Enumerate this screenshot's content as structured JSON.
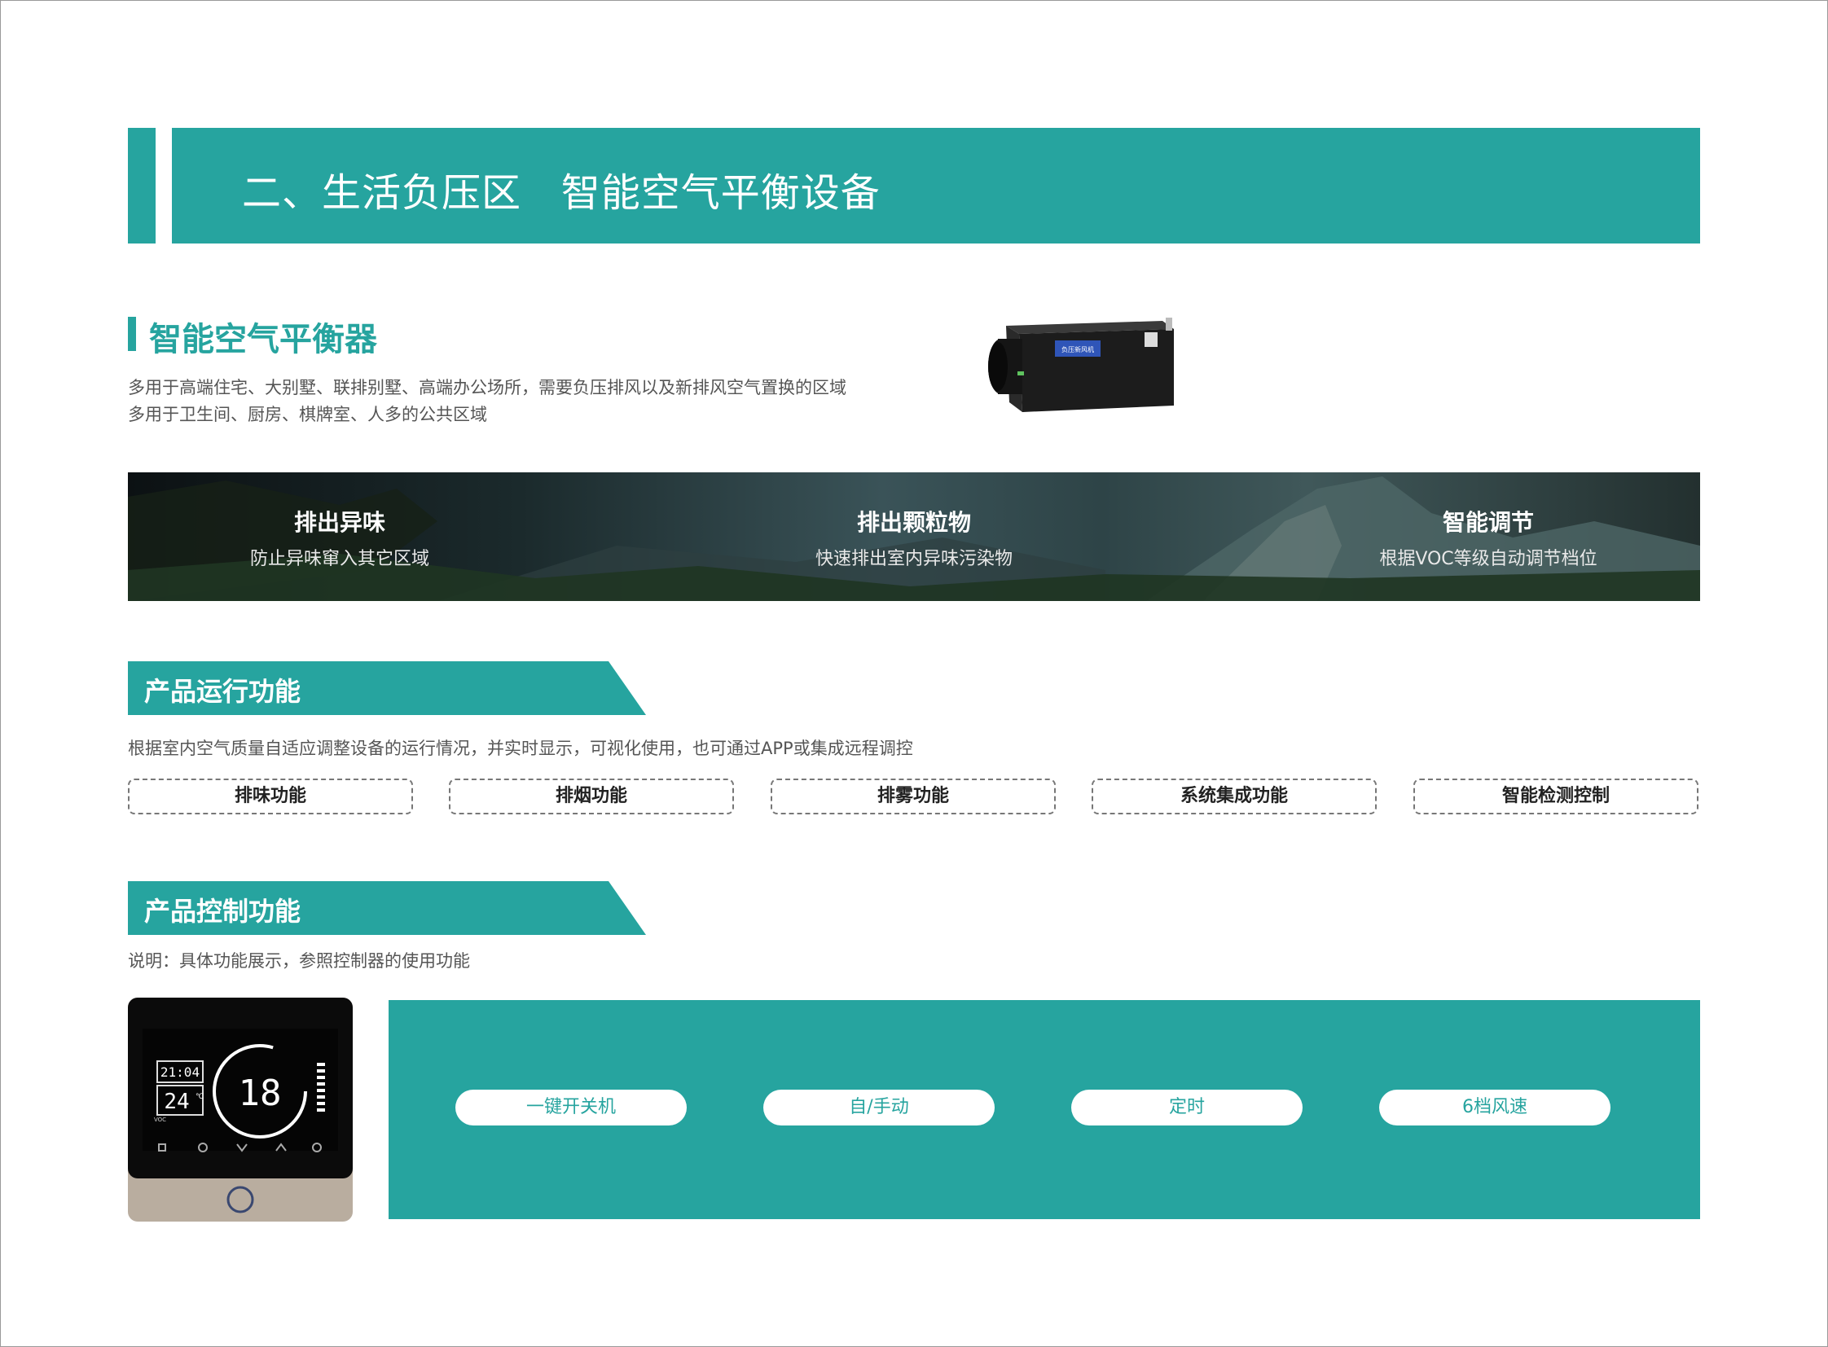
{
  "header": {
    "title": "二、生活负压区   智能空气平衡设备"
  },
  "section1": {
    "title": "智能空气平衡器",
    "desc_lines": [
      "多用于高端住宅、大别墅、联排别墅、高端办公场所，需要负压排风以及新排风空气置换的区域",
      "多用于卫生间、厨房、棋牌室、人多的公共区域"
    ],
    "product_label": "负压新风机"
  },
  "features": [
    {
      "title": "排出异味",
      "sub": "防止异味窜入其它区域"
    },
    {
      "title": "排出颗粒物",
      "sub": "快速排出室内异味污染物"
    },
    {
      "title": "智能调节",
      "sub": "根据VOC等级自动调节档位"
    }
  ],
  "operation": {
    "title": "产品运行功能",
    "desc": "根据室内空气质量自适应调整设备的运行情况，并实时显示，可视化使用，也可通过APP或集成远程调控",
    "functions": [
      "排味功能",
      "排烟功能",
      "排雾功能",
      "系统集成功能",
      "智能检测控制"
    ]
  },
  "control": {
    "title": "产品控制功能",
    "desc": "说明：具体功能展示，参照控制器的使用功能",
    "display": {
      "time": "21:04",
      "temp": "24",
      "temp_unit": "℃",
      "main": "18",
      "voc": "VOC"
    },
    "buttons": [
      "一键开关机",
      "自/手动",
      "定时",
      "6档风速"
    ]
  },
  "colors": {
    "accent": "#26a49f",
    "text": "#555555"
  }
}
